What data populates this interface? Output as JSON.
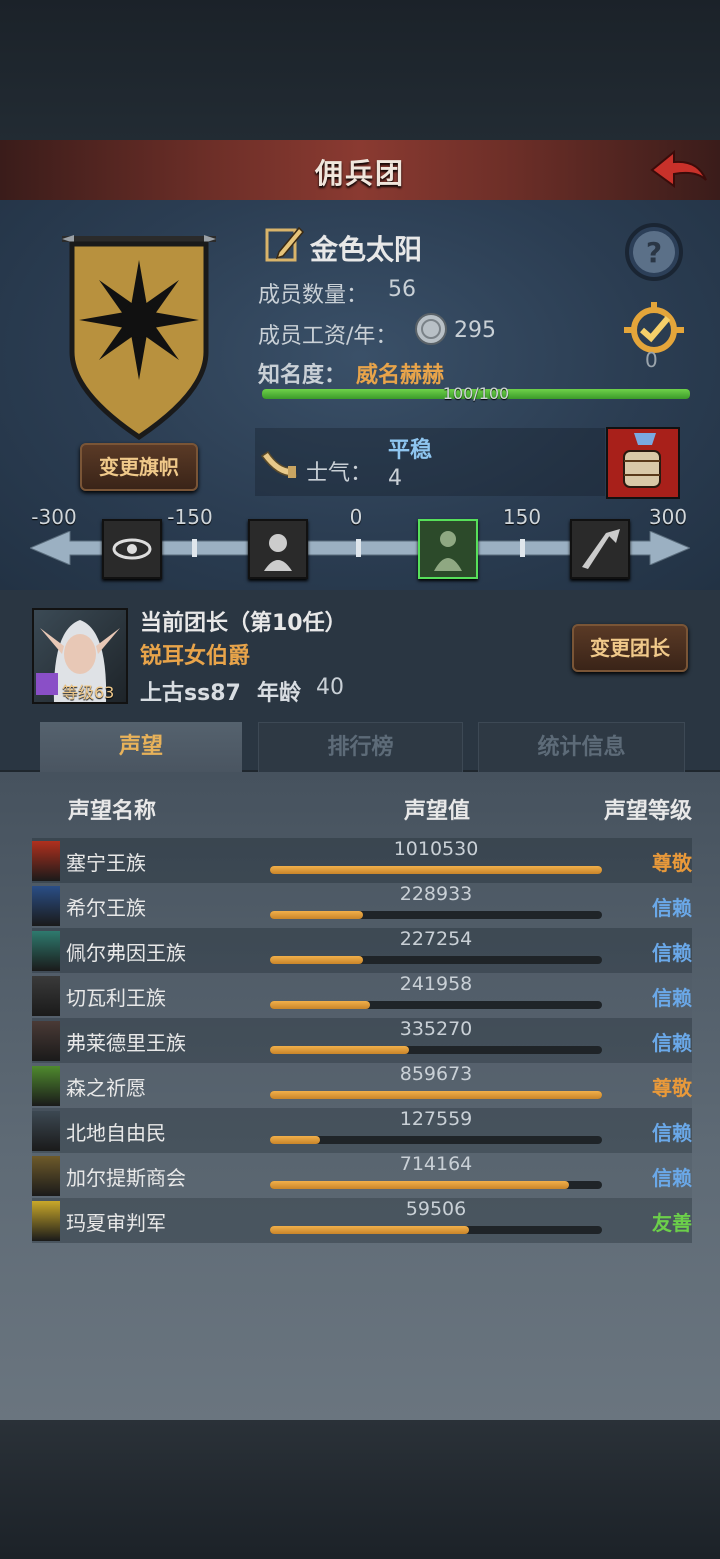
{
  "header": {
    "title": "佣兵团"
  },
  "guild": {
    "name": "金色太阳",
    "members_label": "成员数量：",
    "members_value": "56",
    "wage_label": "成员工资/年：",
    "wage_value": "295",
    "fame_label": "知名度：",
    "fame_value": "威名赫赫",
    "fame_progress": "100/100",
    "fame_fraction": 1.0,
    "pending_count": "0",
    "change_flag_label": "变更旗帜"
  },
  "morale": {
    "label": "士气：",
    "state": "平稳",
    "value": "4",
    "scale_labels": [
      "-300",
      "-150",
      "0",
      "150",
      "300"
    ],
    "active_level": 3,
    "icons": [
      "eye-icon",
      "despair-icon",
      "calm-icon",
      "charge-icon"
    ]
  },
  "leader": {
    "title": "当前团长（第10任）",
    "name": "锐耳女伯爵",
    "id": "上古ss87",
    "age_label": "年龄",
    "age": "40",
    "level": "等级63",
    "change_label": "变更团长"
  },
  "tabs": [
    "声望",
    "排行榜",
    "统计信息"
  ],
  "reputation": {
    "headers": [
      "声望名称",
      "声望值",
      "声望等级"
    ],
    "rows": [
      {
        "name": "塞宁王族",
        "value": "1010530",
        "fill": 1.0,
        "level": "尊敬",
        "color": "#e8993a",
        "icon_color": "#b0301e"
      },
      {
        "name": "希尔王族",
        "value": "228933",
        "fill": 0.28,
        "level": "信赖",
        "color": "#6aa8e8",
        "icon_color": "#2a4e86"
      },
      {
        "name": "佩尔弗因王族",
        "value": "227254",
        "fill": 0.28,
        "level": "信赖",
        "color": "#6aa8e8",
        "icon_color": "#2e7a6e"
      },
      {
        "name": "切瓦利王族",
        "value": "241958",
        "fill": 0.3,
        "level": "信赖",
        "color": "#6aa8e8",
        "icon_color": "#3a3a3a"
      },
      {
        "name": "弗莱德里王族",
        "value": "335270",
        "fill": 0.42,
        "level": "信赖",
        "color": "#6aa8e8",
        "icon_color": "#4a3a36"
      },
      {
        "name": "森之祈愿",
        "value": "859673",
        "fill": 1.0,
        "level": "尊敬",
        "color": "#e8993a",
        "icon_color": "#4f8a2e"
      },
      {
        "name": "北地自由民",
        "value": "127559",
        "fill": 0.15,
        "level": "信赖",
        "color": "#6aa8e8",
        "icon_color": "#3c4852"
      },
      {
        "name": "加尔提斯商会",
        "value": "714164",
        "fill": 0.9,
        "level": "信赖",
        "color": "#6aa8e8",
        "icon_color": "#6e5a2a"
      },
      {
        "name": "玛夏审判军",
        "value": "59506",
        "fill": 0.6,
        "level": "友善",
        "color": "#6ccf4a",
        "icon_color": "#c9a82a"
      }
    ]
  }
}
